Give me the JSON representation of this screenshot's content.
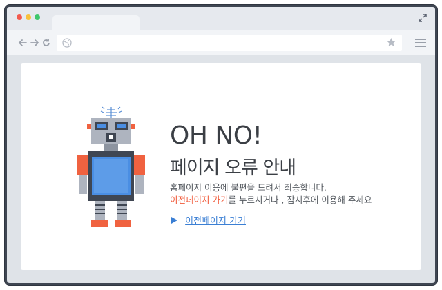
{
  "browser": {
    "url": "",
    "icons": {
      "close": "close-dot",
      "minimize": "minimize-dot",
      "maximize": "maximize-dot",
      "expand": "expand-icon",
      "back": "back-arrow-icon",
      "forward": "forward-arrow-icon",
      "reload": "reload-icon",
      "site": "globe-icon",
      "bookmark": "star-icon",
      "menu": "menu-icon"
    }
  },
  "page": {
    "title": "OH NO!",
    "subtitle": "페이지 오류 안내",
    "description_line1": "홈페이지 이용에 불편을 드려서 죄송합니다.",
    "description_line2_link": "이전페이지 가기",
    "description_line2_rest": "를 누르시거나 , 잠시후에 이용해 주세요",
    "back_link_label": "이전페이지 가기"
  },
  "colors": {
    "accent_red": "#f15a3a",
    "link_blue": "#3b7fd4",
    "robot_gray": "#aeb4bf",
    "robot_dark": "#3f4652",
    "robot_screen": "#4a8ee3"
  }
}
